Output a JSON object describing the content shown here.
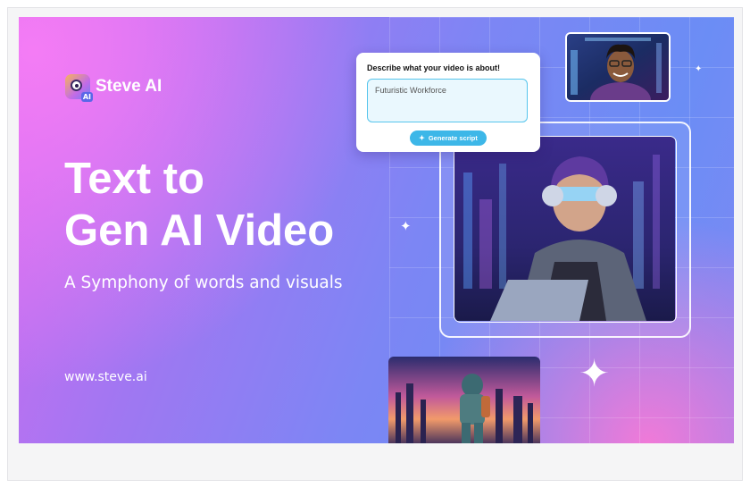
{
  "brand": {
    "name": "Steve AI",
    "badge": "AI",
    "url": "www.steve.ai"
  },
  "hero": {
    "title_line1": "Text to",
    "title_line2": "Gen AI Video",
    "subtitle": "A Symphony of words and visuals"
  },
  "prompt_panel": {
    "title": "Describe what your video is about!",
    "input_value": "Futuristic Workforce",
    "button_label": "Generate script",
    "button_icon": "sparkle-wand-icon"
  },
  "images": [
    {
      "name": "smiling-man-photo"
    },
    {
      "name": "vr-headset-woman-laptop-photo"
    },
    {
      "name": "astronaut-city-photo"
    }
  ],
  "colors": {
    "accent": "#3db7e8",
    "gradient_start": "#f47cf5",
    "gradient_end": "#6b8df5"
  }
}
